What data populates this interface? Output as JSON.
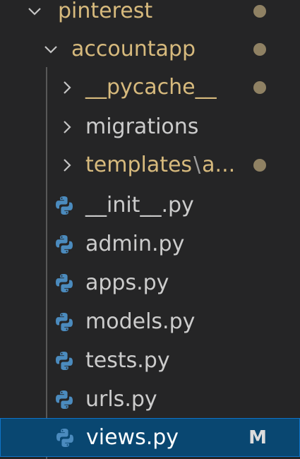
{
  "explorer": {
    "tree": [
      {
        "name": "pinterest",
        "type": "folder",
        "expanded": true,
        "status": "modified-dot"
      },
      {
        "name": "accountapp",
        "type": "folder",
        "expanded": true,
        "status": "modified-dot"
      },
      {
        "name": "__pycache__",
        "type": "folder",
        "expanded": false,
        "status": "modified-dot"
      },
      {
        "name": "migrations",
        "type": "folder",
        "expanded": false,
        "status": ""
      },
      {
        "name": "templates",
        "suffix": "a...",
        "type": "folder",
        "expanded": false,
        "status": "modified-dot"
      },
      {
        "name": "__init__.py",
        "type": "file",
        "icon": "python-icon"
      },
      {
        "name": "admin.py",
        "type": "file",
        "icon": "python-icon"
      },
      {
        "name": "apps.py",
        "type": "file",
        "icon": "python-icon"
      },
      {
        "name": "models.py",
        "type": "file",
        "icon": "python-icon"
      },
      {
        "name": "tests.py",
        "type": "file",
        "icon": "python-icon"
      },
      {
        "name": "urls.py",
        "type": "file",
        "icon": "python-icon"
      },
      {
        "name": "views.py",
        "type": "file",
        "icon": "python-icon",
        "selected": true,
        "badge": "M"
      }
    ],
    "path_separator": "\\"
  },
  "colors": {
    "background": "#252526",
    "git_modified_folder": "#d7ba7d",
    "file_text": "#cccccc",
    "selection_bg": "#094771",
    "selection_border": "#0e73c8",
    "dot": "#8f8163",
    "python_blue": "#4b8bbe",
    "python_yellow": "#ffd43b"
  }
}
